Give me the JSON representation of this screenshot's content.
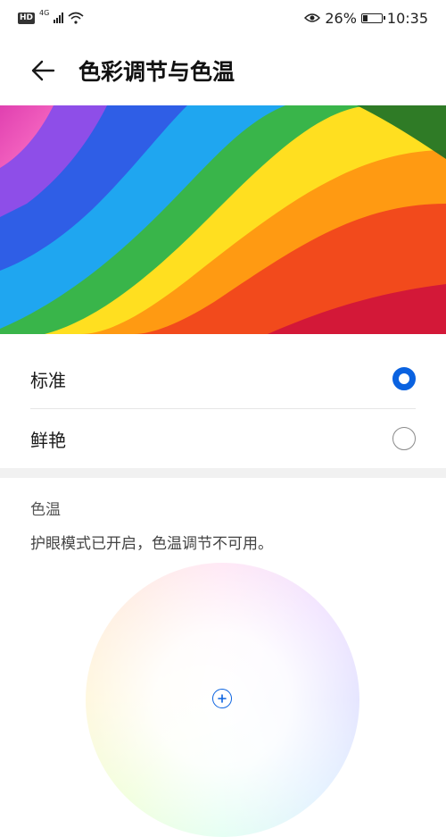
{
  "status_bar": {
    "hd_label": "HD",
    "network_label": "4G",
    "battery_percent_text": "26%",
    "battery_level": 0.26,
    "time": "10:35",
    "icons": [
      "hd-icon",
      "signal-icon",
      "wifi-icon",
      "eye-comfort-icon",
      "battery-icon"
    ]
  },
  "header": {
    "title": "色彩调节与色温",
    "back_icon": "back-arrow-icon"
  },
  "color_modes": {
    "options": [
      {
        "label": "标准",
        "selected": true
      },
      {
        "label": "鲜艳",
        "selected": false
      }
    ]
  },
  "color_temperature": {
    "title": "色温",
    "notice": "护眼模式已开启，色温调节不可用。",
    "cursor_icon": "plus-circle-icon"
  },
  "colors": {
    "accent": "#0a62e0",
    "section_gap": "#f1f1f1",
    "divider": "#e6e6e6"
  }
}
